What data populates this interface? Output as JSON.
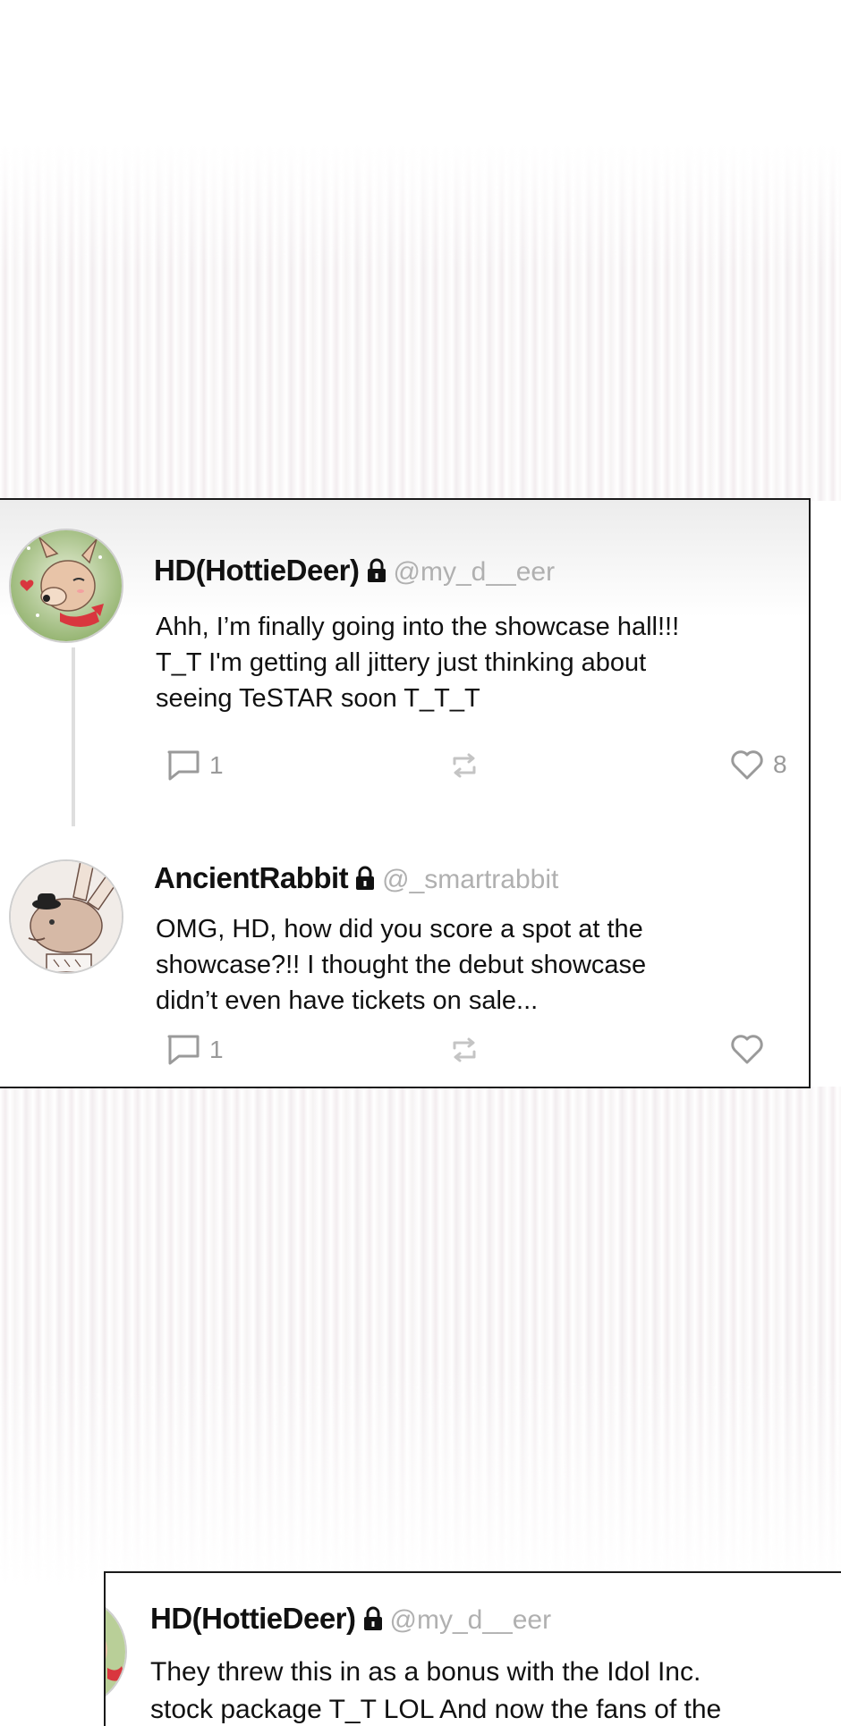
{
  "posts": [
    {
      "display_name": "HD(HottieDeer)",
      "handle": "@my_d__eer",
      "body": "Ahh, I’m finally going into the showcase hall!!! T_T I'm getting all jittery just thinking about seeing TeSTAR soon T_T_T",
      "body_lines": [
        "Ahh, I’m finally going into the showcase hall!!!",
        "T_T I'm getting all jittery just thinking about",
        "seeing TeSTAR soon T_T_T"
      ],
      "reply_count": "1",
      "like_count": "8"
    },
    {
      "display_name": "AncientRabbit",
      "handle": "@_smartrabbit",
      "body_lines": [
        "OMG, HD, how did you score a spot at the",
        "showcase?!! I thought the debut showcase",
        "didn’t even have tickets on sale..."
      ],
      "reply_count": "1"
    },
    {
      "display_name": "HD(HottieDeer)",
      "handle": "@my_d__eer",
      "body_lines": [
        "They threw this in as a bonus with the Idol Inc.",
        "stock package T_T LOL And now the fans of the"
      ]
    }
  ],
  "icons": {
    "reply": "speech-bubble-icon",
    "retweet": "retweet-icon",
    "like": "heart-icon",
    "lock": "lock-icon"
  },
  "colors": {
    "text": "#111111",
    "handle": "#b0b0b0",
    "action": "#9a9a9a",
    "border": "#1a1a1a"
  }
}
